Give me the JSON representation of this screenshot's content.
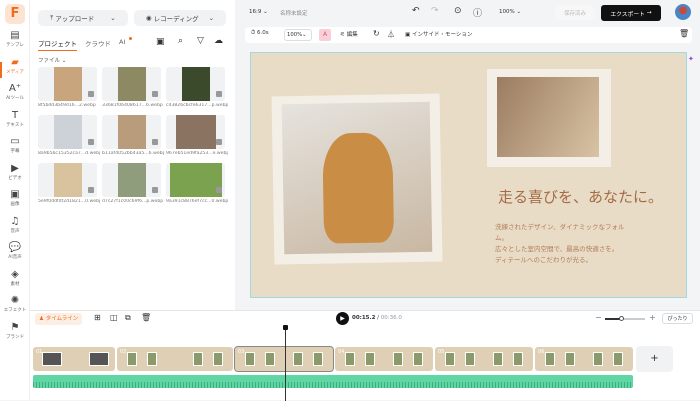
{
  "rail": {
    "items": [
      {
        "icon": "template-icon",
        "label": "テンプレ"
      },
      {
        "icon": "media-icon",
        "label": "メディア"
      },
      {
        "icon": "ai-tools-icon",
        "label": "AIツール"
      },
      {
        "icon": "text-icon",
        "label": "テキスト"
      },
      {
        "icon": "subtitle-icon",
        "label": "字幕"
      },
      {
        "icon": "video-icon",
        "label": "ビデオ"
      },
      {
        "icon": "image-icon",
        "label": "画像"
      },
      {
        "icon": "audio-icon",
        "label": "音声"
      },
      {
        "icon": "ai-voice-icon",
        "label": "AI音声"
      },
      {
        "icon": "elements-icon",
        "label": "素材"
      },
      {
        "icon": "effects-icon",
        "label": "エフェクト"
      },
      {
        "icon": "brand-icon",
        "label": "ブランド"
      }
    ],
    "active": 1
  },
  "panel": {
    "upload": "アップロード",
    "record": "レコーディング",
    "tabs": [
      "プロジェクト",
      "クラウド",
      "AI"
    ],
    "folder": "ファイル",
    "files": [
      {
        "name": "8f5bdd3b49d16...2.webp",
        "color": "#c9a57e"
      },
      {
        "name": "33681f06408617...6.webp",
        "color": "#8d8a63"
      },
      {
        "name": "c43826cbcfe6317...p.webp",
        "color": "#3c4a2c"
      },
      {
        "name": "8a9b5bc15352ca7...d.webp",
        "color": "#cdd2d8"
      },
      {
        "name": "b11af4052bb43a5...6.webp",
        "color": "#b89c7c"
      },
      {
        "name": "967eb51ed9fa253...e.webp",
        "color": "#8a7360"
      },
      {
        "name": "5e9f0ddfdf2d1821...0.webp",
        "color": "#d9c39e"
      },
      {
        "name": "d7c27f1c00c69f6...p.webp",
        "color": "#8f9d7c"
      },
      {
        "name": "9a391c8876ef7cc...0.webp",
        "color": "#7aa24f"
      }
    ]
  },
  "topbar": {
    "aspect": "16:9",
    "title": "名称未設定",
    "zoom": "100%",
    "saved": "保存済み",
    "export": "エクスポート"
  },
  "toolbar": {
    "duration": "6.0s",
    "scale": "100%",
    "adjust": "編集",
    "motion": "インサイド・モーション"
  },
  "slide": {
    "headline": "走る喜びを、あなたに。",
    "body": [
      "洗練されたデザイン、ダイナミックなフォルム。",
      "広々とした室内空間で、最高の快適さを。",
      "ディテールへのこだわりが光る。"
    ]
  },
  "timeline": {
    "label": "タイムライン",
    "current": "00:15.2",
    "total": "00:36.0",
    "fit": "ぴったり",
    "clips": [
      "01",
      "02",
      "03",
      "04",
      "05",
      "06"
    ]
  },
  "colors": {
    "accent": "#f26b1d",
    "audio": "#5fd6a3",
    "export_bg": "#111111"
  }
}
